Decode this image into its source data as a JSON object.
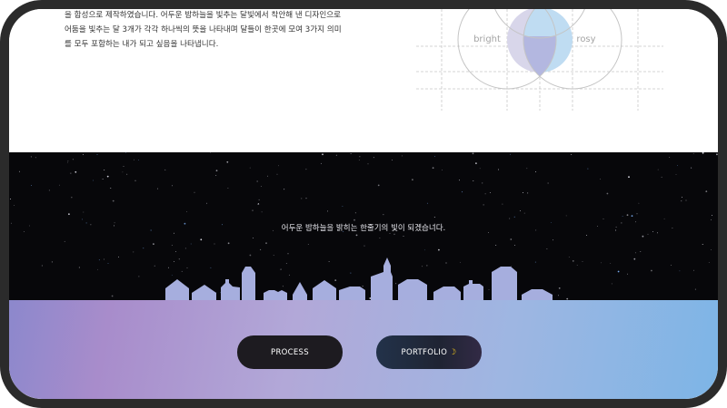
{
  "description": {
    "lines": [
      "을 합성으로 제작하였습니다. 어두운 밤하늘을 빛추는 달빛에서 착안해 낸 디자인으로",
      "어둠을 빛추는 달 3개가 각각 하나씩의 뜻을 나타내며 달들이 한곳에 모여 3가지 의미",
      "를 모두 포함하는 내가 되고 싶음을 나타냅니다."
    ]
  },
  "venn": {
    "label_left": "bright",
    "label_right": "rosy"
  },
  "night": {
    "tagline": "어두운 밤하늘을 밝히는 한줄기의 빛이 되겠습니다."
  },
  "buttons": {
    "process": "PROCESS",
    "portfolio": "PORTFOLIO"
  },
  "colors": {
    "accent_moon": "#f0c419",
    "night_bg": "#07070a",
    "skyline": "#a6aede"
  }
}
